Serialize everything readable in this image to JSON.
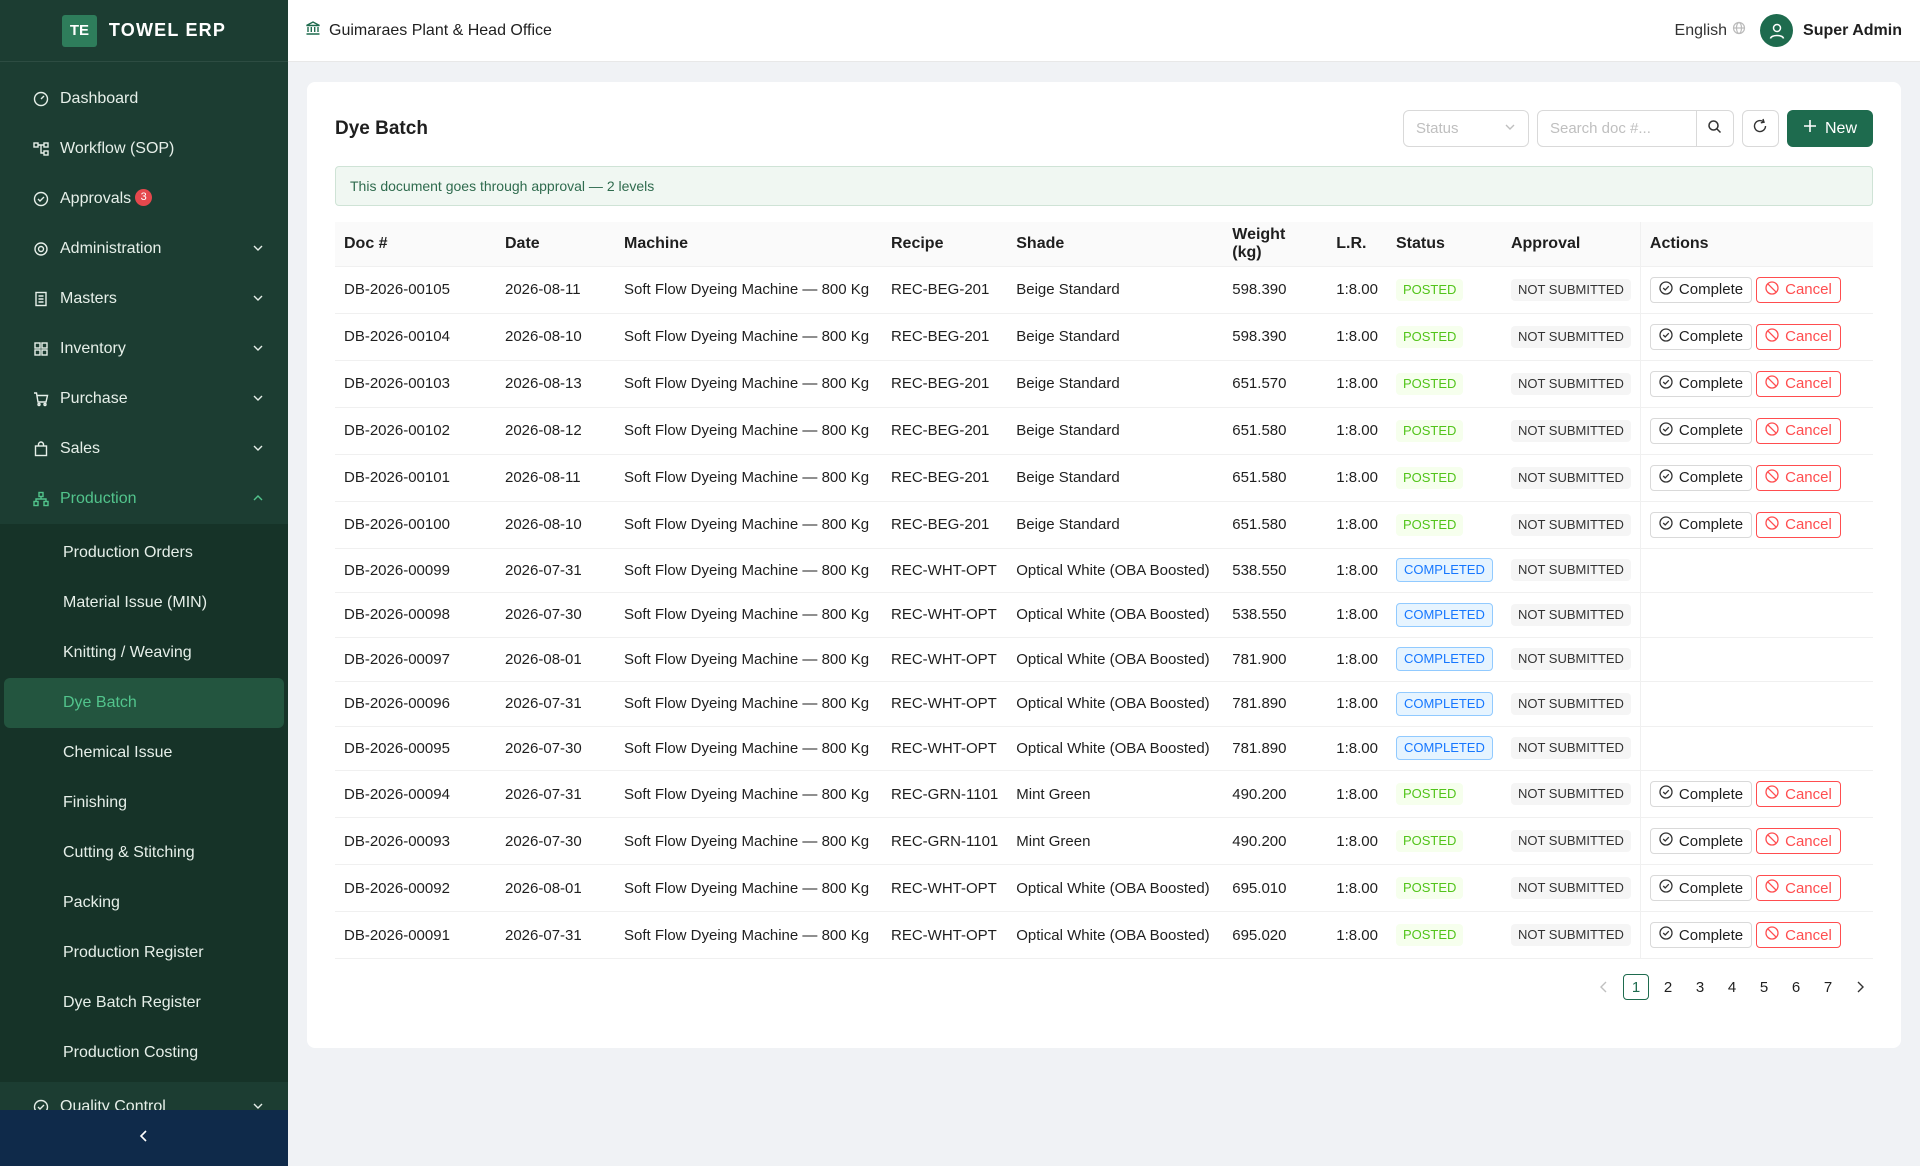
{
  "brand": {
    "logo": "TE",
    "name": "TOWEL ERP"
  },
  "sidebar": {
    "items": [
      {
        "label": "Dashboard",
        "icon": "dashboard-icon"
      },
      {
        "label": "Workflow (SOP)",
        "icon": "workflow-icon"
      },
      {
        "label": "Approvals",
        "icon": "approval-icon",
        "badge": "3"
      },
      {
        "label": "Administration",
        "icon": "gear-icon"
      },
      {
        "label": "Masters",
        "icon": "book-icon"
      },
      {
        "label": "Inventory",
        "icon": "grid-icon"
      },
      {
        "label": "Purchase",
        "icon": "cart-icon"
      },
      {
        "label": "Sales",
        "icon": "bag-icon"
      },
      {
        "label": "Production",
        "icon": "cluster-icon"
      }
    ],
    "production_sub": [
      "Production Orders",
      "Material Issue (MIN)",
      "Knitting / Weaving",
      "Dye Batch",
      "Chemical Issue",
      "Finishing",
      "Cutting & Stitching",
      "Packing",
      "Production Register",
      "Dye Batch Register",
      "Production Costing"
    ],
    "after": {
      "label": "Quality Control",
      "icon": "shield-check-icon"
    }
  },
  "header": {
    "org": "Guimaraes Plant & Head Office",
    "language": "English",
    "user": "Super Admin"
  },
  "page": {
    "title": "Dye Batch",
    "status_placeholder": "Status",
    "search_placeholder": "Search doc #...",
    "new_label": "New",
    "info": "This document goes through approval — 2 levels",
    "columns": [
      "Doc #",
      "Date",
      "Machine",
      "Recipe",
      "Shade",
      "Weight (kg)",
      "L.R.",
      "Status",
      "Approval",
      "Actions"
    ],
    "complete_label": "Complete",
    "cancel_label": "Cancel",
    "rows": [
      {
        "doc": "DB-2026-00105",
        "date": "2026-08-11",
        "machine": "Soft Flow Dyeing Machine — 800 Kg",
        "recipe": "REC-BEG-201",
        "shade": "Beige Standard",
        "weight": "598.390",
        "lr": "1:8.00",
        "status": "POSTED",
        "approval": "NOT SUBMITTED"
      },
      {
        "doc": "DB-2026-00104",
        "date": "2026-08-10",
        "machine": "Soft Flow Dyeing Machine — 800 Kg",
        "recipe": "REC-BEG-201",
        "shade": "Beige Standard",
        "weight": "598.390",
        "lr": "1:8.00",
        "status": "POSTED",
        "approval": "NOT SUBMITTED"
      },
      {
        "doc": "DB-2026-00103",
        "date": "2026-08-13",
        "machine": "Soft Flow Dyeing Machine — 800 Kg",
        "recipe": "REC-BEG-201",
        "shade": "Beige Standard",
        "weight": "651.570",
        "lr": "1:8.00",
        "status": "POSTED",
        "approval": "NOT SUBMITTED"
      },
      {
        "doc": "DB-2026-00102",
        "date": "2026-08-12",
        "machine": "Soft Flow Dyeing Machine — 800 Kg",
        "recipe": "REC-BEG-201",
        "shade": "Beige Standard",
        "weight": "651.580",
        "lr": "1:8.00",
        "status": "POSTED",
        "approval": "NOT SUBMITTED"
      },
      {
        "doc": "DB-2026-00101",
        "date": "2026-08-11",
        "machine": "Soft Flow Dyeing Machine — 800 Kg",
        "recipe": "REC-BEG-201",
        "shade": "Beige Standard",
        "weight": "651.580",
        "lr": "1:8.00",
        "status": "POSTED",
        "approval": "NOT SUBMITTED"
      },
      {
        "doc": "DB-2026-00100",
        "date": "2026-08-10",
        "machine": "Soft Flow Dyeing Machine — 800 Kg",
        "recipe": "REC-BEG-201",
        "shade": "Beige Standard",
        "weight": "651.580",
        "lr": "1:8.00",
        "status": "POSTED",
        "approval": "NOT SUBMITTED"
      },
      {
        "doc": "DB-2026-00099",
        "date": "2026-07-31",
        "machine": "Soft Flow Dyeing Machine — 800 Kg",
        "recipe": "REC-WHT-OPT",
        "shade": "Optical White (OBA Boosted)",
        "weight": "538.550",
        "lr": "1:8.00",
        "status": "COMPLETED",
        "approval": "NOT SUBMITTED"
      },
      {
        "doc": "DB-2026-00098",
        "date": "2026-07-30",
        "machine": "Soft Flow Dyeing Machine — 800 Kg",
        "recipe": "REC-WHT-OPT",
        "shade": "Optical White (OBA Boosted)",
        "weight": "538.550",
        "lr": "1:8.00",
        "status": "COMPLETED",
        "approval": "NOT SUBMITTED"
      },
      {
        "doc": "DB-2026-00097",
        "date": "2026-08-01",
        "machine": "Soft Flow Dyeing Machine — 800 Kg",
        "recipe": "REC-WHT-OPT",
        "shade": "Optical White (OBA Boosted)",
        "weight": "781.900",
        "lr": "1:8.00",
        "status": "COMPLETED",
        "approval": "NOT SUBMITTED"
      },
      {
        "doc": "DB-2026-00096",
        "date": "2026-07-31",
        "machine": "Soft Flow Dyeing Machine — 800 Kg",
        "recipe": "REC-WHT-OPT",
        "shade": "Optical White (OBA Boosted)",
        "weight": "781.890",
        "lr": "1:8.00",
        "status": "COMPLETED",
        "approval": "NOT SUBMITTED"
      },
      {
        "doc": "DB-2026-00095",
        "date": "2026-07-30",
        "machine": "Soft Flow Dyeing Machine — 800 Kg",
        "recipe": "REC-WHT-OPT",
        "shade": "Optical White (OBA Boosted)",
        "weight": "781.890",
        "lr": "1:8.00",
        "status": "COMPLETED",
        "approval": "NOT SUBMITTED"
      },
      {
        "doc": "DB-2026-00094",
        "date": "2026-07-31",
        "machine": "Soft Flow Dyeing Machine — 800 Kg",
        "recipe": "REC-GRN-1101",
        "shade": "Mint Green",
        "weight": "490.200",
        "lr": "1:8.00",
        "status": "POSTED",
        "approval": "NOT SUBMITTED"
      },
      {
        "doc": "DB-2026-00093",
        "date": "2026-07-30",
        "machine": "Soft Flow Dyeing Machine — 800 Kg",
        "recipe": "REC-GRN-1101",
        "shade": "Mint Green",
        "weight": "490.200",
        "lr": "1:8.00",
        "status": "POSTED",
        "approval": "NOT SUBMITTED"
      },
      {
        "doc": "DB-2026-00092",
        "date": "2026-08-01",
        "machine": "Soft Flow Dyeing Machine — 800 Kg",
        "recipe": "REC-WHT-OPT",
        "shade": "Optical White (OBA Boosted)",
        "weight": "695.010",
        "lr": "1:8.00",
        "status": "POSTED",
        "approval": "NOT SUBMITTED"
      },
      {
        "doc": "DB-2026-00091",
        "date": "2026-07-31",
        "machine": "Soft Flow Dyeing Machine — 800 Kg",
        "recipe": "REC-WHT-OPT",
        "shade": "Optical White (OBA Boosted)",
        "weight": "695.020",
        "lr": "1:8.00",
        "status": "POSTED",
        "approval": "NOT SUBMITTED"
      }
    ],
    "pages": [
      "1",
      "2",
      "3",
      "4",
      "5",
      "6",
      "7"
    ],
    "current_page": "1"
  },
  "colors": {
    "sidebar": "#1c3d32",
    "accent": "#1e6b4e",
    "active_text": "#52c48c",
    "posted": "#52c41a",
    "completed": "#1677ff",
    "danger": "#ff4d4f"
  }
}
